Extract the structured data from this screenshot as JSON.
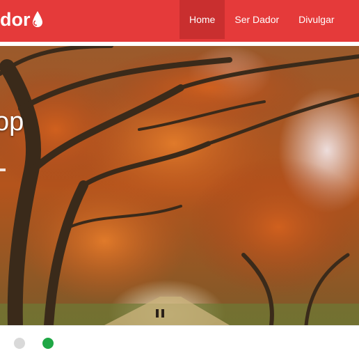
{
  "navbar": {
    "brand": "dor",
    "items": [
      {
        "label": "Home",
        "active": true
      },
      {
        "label": "Ser Dador",
        "active": false
      },
      {
        "label": "Divulgar",
        "active": false
      }
    ]
  },
  "carousel": {
    "caption": "op",
    "active_slide": 2,
    "slide_count": 2
  },
  "colors": {
    "brand_red": "#e53a3a",
    "active_nav": "#c92f2f",
    "indicator_active": "#1fa745",
    "indicator_inactive": "#d9d9d9"
  }
}
